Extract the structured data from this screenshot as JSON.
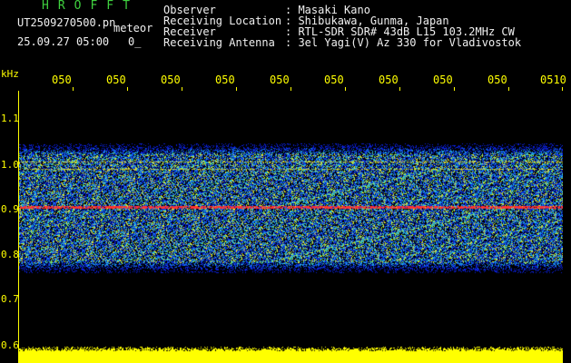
{
  "header": {
    "brand": "HROFFT",
    "filename": "UT2509270500.pn",
    "meteor_label": "meteor",
    "datetime": "25.09.27 05:00",
    "count": "0_"
  },
  "station_info": [
    {
      "label": "Observer",
      "value": ": Masaki Kano"
    },
    {
      "label": "Receiving Location",
      "value": ": Shibukawa, Gunma, Japan"
    },
    {
      "label": "Receiver",
      "value": ": RTL-SDR SDR# 43dB L15 103.2MHz CW"
    },
    {
      "label": "Receiving Antenna",
      "value": ": 3el Yagi(V) Az 330 for Vladivostok"
    }
  ],
  "axis": {
    "unit": "kHz",
    "x_ticks": [
      "050",
      "050",
      "050",
      "050",
      "050",
      "050",
      "050",
      "050",
      "050",
      "0510"
    ],
    "y_ticks": [
      "1.1",
      "1.0",
      "0.9",
      "0.8",
      "0.7",
      "0.6"
    ]
  },
  "colors": {
    "brand": "#3fd13f",
    "labels": "#ffff00",
    "text": "#f0f0f0",
    "signal_line": "#ff3030",
    "background_noise": "#0a1ad0"
  }
}
